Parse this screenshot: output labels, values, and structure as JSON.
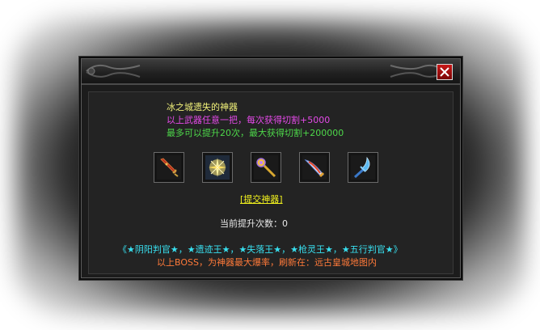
{
  "dialog": {
    "close_label": "✕",
    "title_text": "冰之城遗失的神器",
    "desc_text": "以上武器任意一把，每次获得切割+5000",
    "max_text": "最多可以提升20次，最大获得切割+200000",
    "weapons": [
      {
        "icon": "red-sword-icon"
      },
      {
        "icon": "golden-radiant-sword-icon"
      },
      {
        "icon": "golden-staff-icon"
      },
      {
        "icon": "flame-blade-icon"
      },
      {
        "icon": "blue-crescent-blade-icon"
      }
    ],
    "submit_label": "[提交神器]",
    "count_label": "当前提升次数：",
    "count_value": "0",
    "boss_text": "《★阴阳判官★，★遗迹王★，★失落王★，★枪灵王★，★五行判官★》",
    "note_text": "以上BOSS，为神器最大爆率，刷新在：远古皇城地图内"
  },
  "colors": {
    "title": "#f2f27a",
    "desc": "#e44ae8",
    "max": "#4ed84a",
    "submit": "#f2f21e",
    "boss": "#38e0f0",
    "note": "#ff7a3a",
    "close": "#c81818"
  }
}
